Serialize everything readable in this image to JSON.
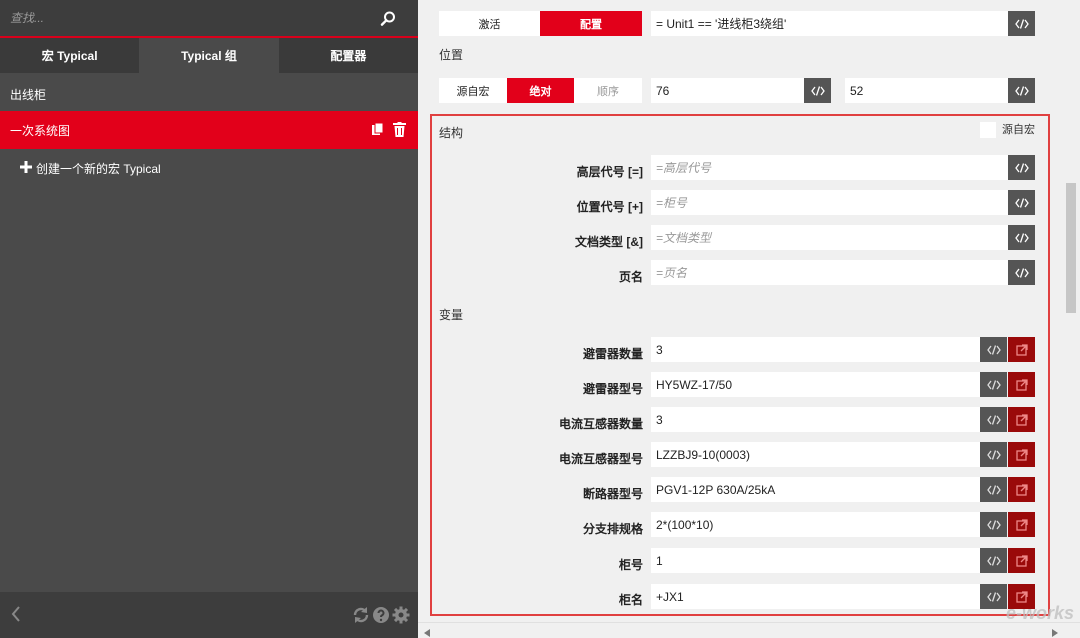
{
  "sidebar": {
    "search_placeholder": "查找...",
    "tabs": [
      {
        "label": "宏 Typical"
      },
      {
        "label": "Typical 组"
      },
      {
        "label": "配置器"
      }
    ],
    "category": "出线柜",
    "selected_item": "一次系统图",
    "create_label": "创建一个新的宏 Typical"
  },
  "main": {
    "mode_tabs": [
      {
        "label": "激活"
      },
      {
        "label": "配置"
      }
    ],
    "condition_value": "= Unit1 == '进线柜3绕组'",
    "position": {
      "title": "位置",
      "modes": [
        {
          "label": "源自宏"
        },
        {
          "label": "绝对"
        },
        {
          "label": "顺序"
        }
      ],
      "x_value": "76",
      "y_value": "52"
    },
    "structure": {
      "title": "结构",
      "source_macro_label": "源自宏",
      "rows": [
        {
          "label": "高层代号 [=]",
          "placeholder": "=高层代号"
        },
        {
          "label": "位置代号 [+]",
          "placeholder": "=柜号"
        },
        {
          "label": "文档类型 [&]",
          "placeholder": "=文档类型"
        },
        {
          "label": "页名",
          "placeholder": "=页名"
        }
      ]
    },
    "variables": {
      "title": "变量",
      "rows": [
        {
          "label": "避雷器数量",
          "value": "3"
        },
        {
          "label": "避雷器型号",
          "value": "HY5WZ-17/50"
        },
        {
          "label": "电流互感器数量",
          "value": "3"
        },
        {
          "label": "电流互感器型号",
          "value": "LZZBJ9-10(0003)"
        },
        {
          "label": "断路器型号",
          "value": "PGV1-12P 630A/25kA"
        },
        {
          "label": "分支排规格",
          "value": "2*(100*10)"
        },
        {
          "label": "柜号",
          "value": "1"
        },
        {
          "label": "柜名",
          "value": "+JX1"
        }
      ]
    }
  },
  "watermark": "e-works",
  "colors": {
    "accent": "#e2001a",
    "sidebar_bg": "#4a4a4a",
    "highlight_box": "#e04040",
    "link_button": "#9a0a0a"
  }
}
